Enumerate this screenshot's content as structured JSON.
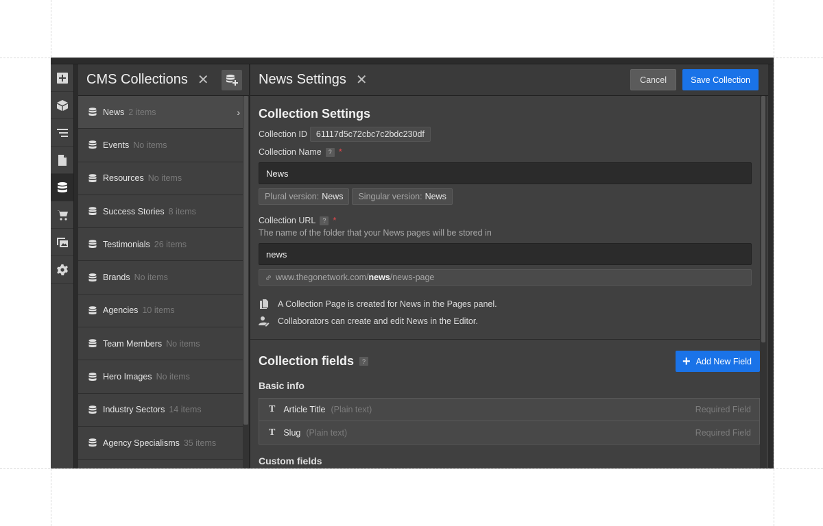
{
  "rail": {
    "items": [
      {
        "icon": "add-panel-icon"
      },
      {
        "icon": "box-icon"
      },
      {
        "icon": "navigator-icon"
      },
      {
        "icon": "pages-icon"
      },
      {
        "icon": "database-icon",
        "active": true
      },
      {
        "icon": "cart-icon"
      },
      {
        "icon": "assets-icon"
      },
      {
        "icon": "gear-icon"
      }
    ]
  },
  "collections": {
    "title": "CMS Collections",
    "close": "✕",
    "items": [
      {
        "name": "News",
        "count": "2 items",
        "active": true
      },
      {
        "name": "Events",
        "count": "No items"
      },
      {
        "name": "Resources",
        "count": "No items"
      },
      {
        "name": "Success Stories",
        "count": "8 items"
      },
      {
        "name": "Testimonials",
        "count": "26 items"
      },
      {
        "name": "Brands",
        "count": "No items"
      },
      {
        "name": "Agencies",
        "count": "10 items"
      },
      {
        "name": "Team Members",
        "count": "No items"
      },
      {
        "name": "Hero Images",
        "count": "No items"
      },
      {
        "name": "Industry Sectors",
        "count": "14 items"
      },
      {
        "name": "Agency Specialisms",
        "count": "35 items"
      }
    ]
  },
  "settings": {
    "title": "News Settings",
    "close": "✕",
    "cancel": "Cancel",
    "save": "Save Collection",
    "section_title": "Collection Settings",
    "id_label": "Collection ID",
    "id_value": "61117d5c72cbc7c2bdc230df",
    "name_label": "Collection Name",
    "help": "?",
    "required": "*",
    "name_value": "News",
    "plural_label": "Plural version:",
    "plural_value": "News",
    "singular_label": "Singular version:",
    "singular_value": "News",
    "url_label": "Collection URL",
    "url_hint": "The name of the folder that your News pages will be stored in",
    "url_value": "news",
    "url_preview_prefix": "www.thegonetwork.com/",
    "url_preview_slug": "news",
    "url_preview_suffix": "/news-page",
    "info_pages": "A Collection Page is created for News in the Pages panel.",
    "info_editor": "Collaborators can create and edit News in the Editor."
  },
  "fields": {
    "title": "Collection fields",
    "add_button": "Add New Field",
    "add_plus": "+",
    "basic_info": "Basic info",
    "custom_fields": "Custom fields",
    "rows": [
      {
        "icon": "T",
        "name": "Article Title",
        "type": "(Plain text)",
        "required": "Required Field"
      },
      {
        "icon": "T",
        "name": "Slug",
        "type": "(Plain text)",
        "required": "Required Field"
      }
    ]
  },
  "colors": {
    "accent": "#1a73e8",
    "panel": "#404040",
    "required": "#e5484d"
  }
}
